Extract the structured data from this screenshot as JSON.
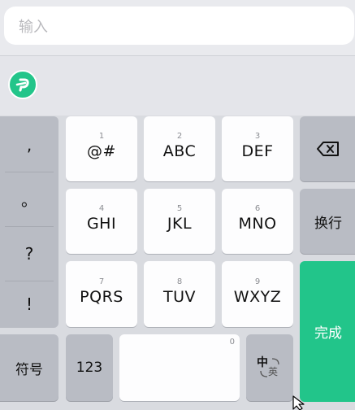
{
  "input": {
    "placeholder": "输入"
  },
  "punctuation": [
    ",",
    "。",
    "?",
    "!"
  ],
  "keys": [
    {
      "num": "1",
      "label": "@#"
    },
    {
      "num": "2",
      "label": "ABC"
    },
    {
      "num": "3",
      "label": "DEF"
    },
    {
      "num": "4",
      "label": "GHI"
    },
    {
      "num": "5",
      "label": "JKL"
    },
    {
      "num": "6",
      "label": "MNO"
    },
    {
      "num": "7",
      "label": "PQRS"
    },
    {
      "num": "8",
      "label": "TUV"
    },
    {
      "num": "9",
      "label": "WXYZ"
    }
  ],
  "side": {
    "newline": "换行",
    "done": "完成"
  },
  "bottom": {
    "symbols": "符号",
    "numbers": "123",
    "space_num": "0",
    "lang_zh": "中",
    "lang_en": "英"
  },
  "colors": {
    "accent": "#22c58a"
  }
}
